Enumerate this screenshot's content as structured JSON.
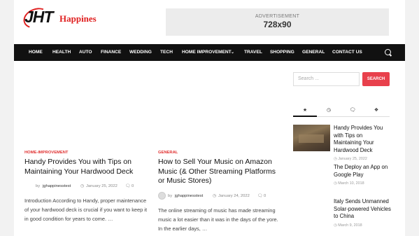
{
  "header": {
    "logo_mark": "JHT",
    "logo_text": "Happines",
    "ad_label": "ADVERTISEMENT",
    "ad_size": "728x90"
  },
  "nav": {
    "items": [
      "HOME",
      "HEALTH",
      "AUTO",
      "FINANCE",
      "WEDDING",
      "TECH",
      "HOME IMPROVEMENT",
      "TRAVEL",
      "SHOPPING",
      "GENERAL",
      "CONTACT US"
    ],
    "dropdown_icon": "chevron-down-icon",
    "search_icon": "search-icon"
  },
  "posts": [
    {
      "category": "HOME-IMPROVEMENT",
      "title": "Handy Provides You with Tips on Maintaining Your Hardwood Deck",
      "author": "jghappinesstest",
      "date": "January 25, 2022",
      "comments": "0",
      "excerpt": "Introduction According to Handy, proper maintenance of your hardwood deck is crucial if you want to keep it in good condition for years to come. …"
    },
    {
      "category": "GENERAL",
      "title": "How to Sell Your Music on Amazon Music (& Other Streaming Platforms or Music Stores)",
      "author": "jghappinesstest",
      "date": "January 24, 2022",
      "comments": "0",
      "excerpt": "The online streaming of music has made streaming music a lot easier than it was in the days of the yore. In the earlier days, …"
    }
  ],
  "sidebar": {
    "search_placeholder": "Search ...",
    "search_button": "SEARCH",
    "tab_icons": [
      "star-icon",
      "clock-icon",
      "comment-icon",
      "tag-icon"
    ],
    "items": [
      {
        "title": "Handy Provides You with Tips on Maintaining Your Hardwood Deck",
        "date": "January 25, 2022"
      },
      {
        "title": "The Deploy an App on Google Play",
        "date": "March 10, 2018"
      },
      {
        "title": "Italy Sends Unmanned Solar-powered Vehicles to China",
        "date": "March 9, 2018"
      }
    ]
  }
}
